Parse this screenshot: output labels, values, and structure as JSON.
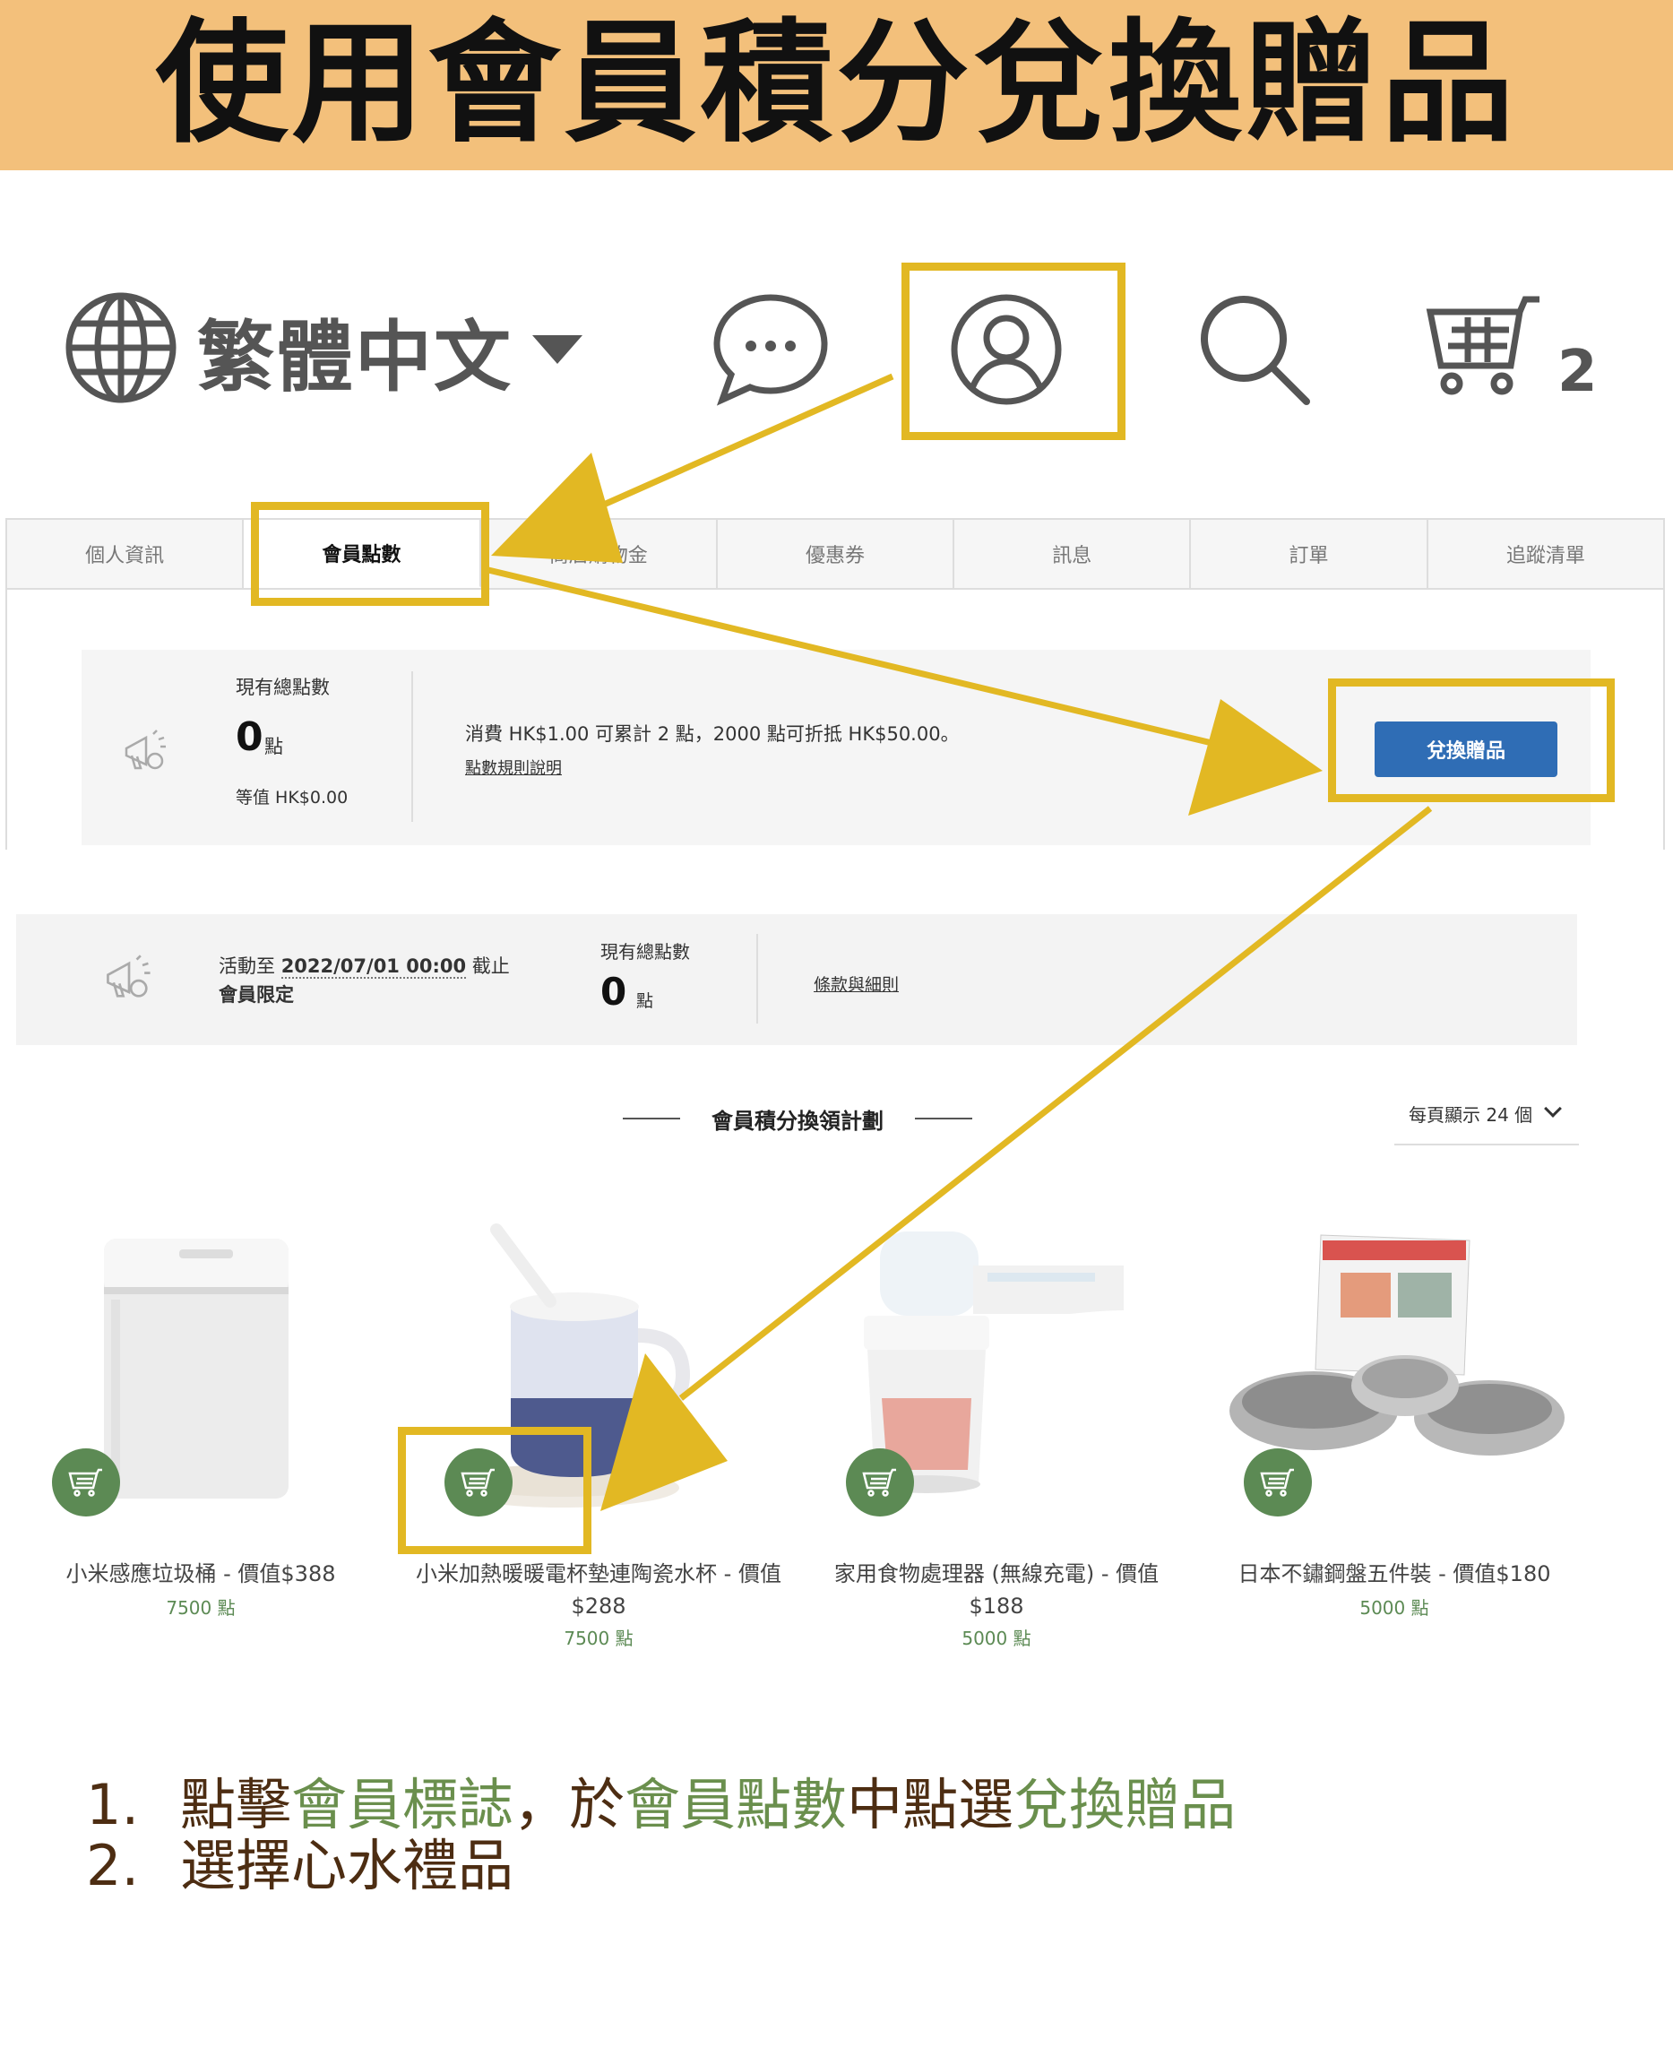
{
  "banner": {
    "title": "使用會員積分兌換贈品"
  },
  "topnav": {
    "language": "繁體中文",
    "cart_count": "2",
    "icons": [
      "globe-icon",
      "chat-icon",
      "user-icon",
      "search-icon",
      "cart-icon"
    ]
  },
  "tabs": [
    "個人資訊",
    "會員點數",
    "商店購物金",
    "優惠券",
    "訊息",
    "訂單",
    "追蹤清單"
  ],
  "points_panel": {
    "total_label": "現有總點數",
    "total_value": "0",
    "unit": "點",
    "equiv": "等值 HK$0.00",
    "rule_text": "消費 HK$1.00 可累計 2 點，2000 點可折抵 HK$50.00。",
    "rule_link": "點數規則說明",
    "redeem_button": "兌換贈品"
  },
  "promo_panel": {
    "until_prefix": "活動至",
    "until_date": "2022/07/01 00:00",
    "until_suffix": "截止",
    "members_only": "會員限定",
    "total_label": "現有總點數",
    "total_value": "0",
    "unit": "點",
    "terms_link": "條款與細則"
  },
  "section": {
    "title": "會員積分換領計劃",
    "per_page": "每頁顯示 24 個"
  },
  "products": [
    {
      "name": "小米感應垃圾桶 - 價值$388",
      "points": "7500 點"
    },
    {
      "name": "小米加熱暖暖電杯墊連陶瓷水杯 - 價值$288",
      "points": "7500 點"
    },
    {
      "name": "家用食物處理器 (無線充電) - 價值$188",
      "points": "5000 點"
    },
    {
      "name": "日本不鏽鋼盤五件裝 - 價值$180",
      "points": "5000 點"
    }
  ],
  "steps": {
    "s1_num": "1.",
    "s1_a": "點擊",
    "s1_b": "會員標誌",
    "s1_c": "，於",
    "s1_d": "會員點數",
    "s1_e": "中點選",
    "s1_f": "兌換贈品",
    "s2_num": "2.",
    "s2_text": "選擇心水禮品"
  },
  "colors": {
    "highlight": "#e2b823",
    "banner": "#f3c07b",
    "button": "#2f6db5",
    "green": "#5c8a54",
    "steps_text": "#4d2d12"
  }
}
